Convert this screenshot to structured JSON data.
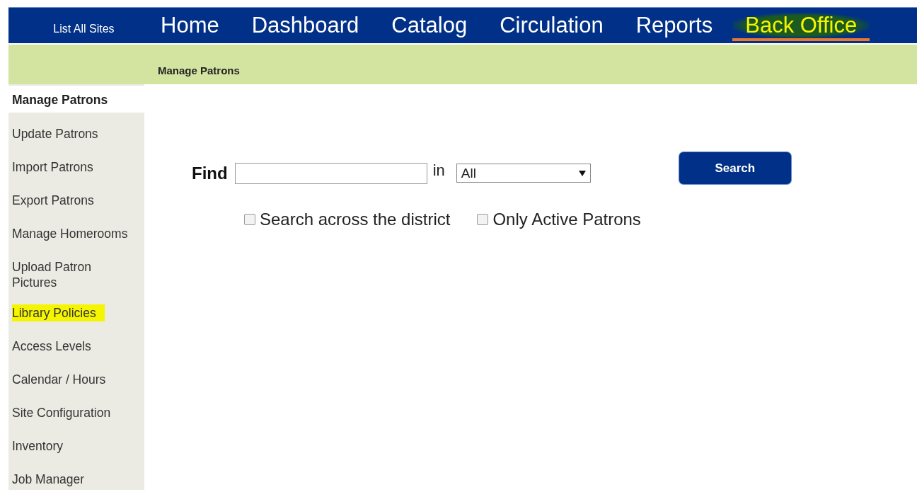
{
  "top_nav": {
    "site_link": "List All Sites",
    "tabs": [
      {
        "label": "Home",
        "selected": false
      },
      {
        "label": "Dashboard",
        "selected": false
      },
      {
        "label": "Catalog",
        "selected": false
      },
      {
        "label": "Circulation",
        "selected": false
      },
      {
        "label": "Reports",
        "selected": false
      },
      {
        "label": "Back Office",
        "selected": true
      }
    ]
  },
  "breadcrumb": "Manage Patrons",
  "sidebar": {
    "items": [
      {
        "label": "Manage Patrons",
        "selected": true,
        "highlighted": false
      },
      {
        "label": "Update Patrons",
        "selected": false,
        "highlighted": false
      },
      {
        "label": "Import Patrons",
        "selected": false,
        "highlighted": false
      },
      {
        "label": "Export Patrons",
        "selected": false,
        "highlighted": false
      },
      {
        "label": "Manage Homerooms",
        "selected": false,
        "highlighted": false
      },
      {
        "label": "Upload Patron Pictures",
        "selected": false,
        "highlighted": false
      },
      {
        "label": "Library Policies",
        "selected": false,
        "highlighted": true
      },
      {
        "label": "Access Levels",
        "selected": false,
        "highlighted": false
      },
      {
        "label": "Calendar / Hours",
        "selected": false,
        "highlighted": false
      },
      {
        "label": "Site Configuration",
        "selected": false,
        "highlighted": false
      },
      {
        "label": "Inventory",
        "selected": false,
        "highlighted": false
      },
      {
        "label": "Job Manager",
        "selected": false,
        "highlighted": false
      }
    ]
  },
  "search": {
    "find_label": "Find",
    "in_label": "in",
    "scope": "All",
    "button": "Search",
    "options": [
      {
        "label": "Search across the district",
        "checked": false
      },
      {
        "label": "Only Active Patrons",
        "checked": false
      }
    ]
  }
}
